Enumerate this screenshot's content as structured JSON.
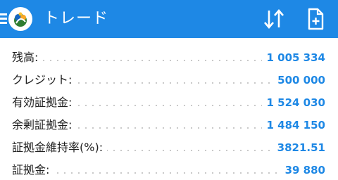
{
  "appbar": {
    "title": "トレード",
    "icons": {
      "menu": "menu-icon",
      "logo": "app-logo-icon",
      "sort": "sort-arrows-icon",
      "new_order": "new-document-plus-icon"
    },
    "color": "#1e88e5"
  },
  "account": {
    "rows": [
      {
        "label": "残高:",
        "value": "1 005 334"
      },
      {
        "label": "クレジット:",
        "value": "500 000"
      },
      {
        "label": "有効証拠金:",
        "value": "1 524 030"
      },
      {
        "label": "余剰証拠金:",
        "value": "1 484 150"
      },
      {
        "label": "証拠金維持率(%):",
        "value": "3821.51"
      },
      {
        "label": "証拠金:",
        "value": "39 880"
      }
    ],
    "value_color": "#1e88e5"
  }
}
